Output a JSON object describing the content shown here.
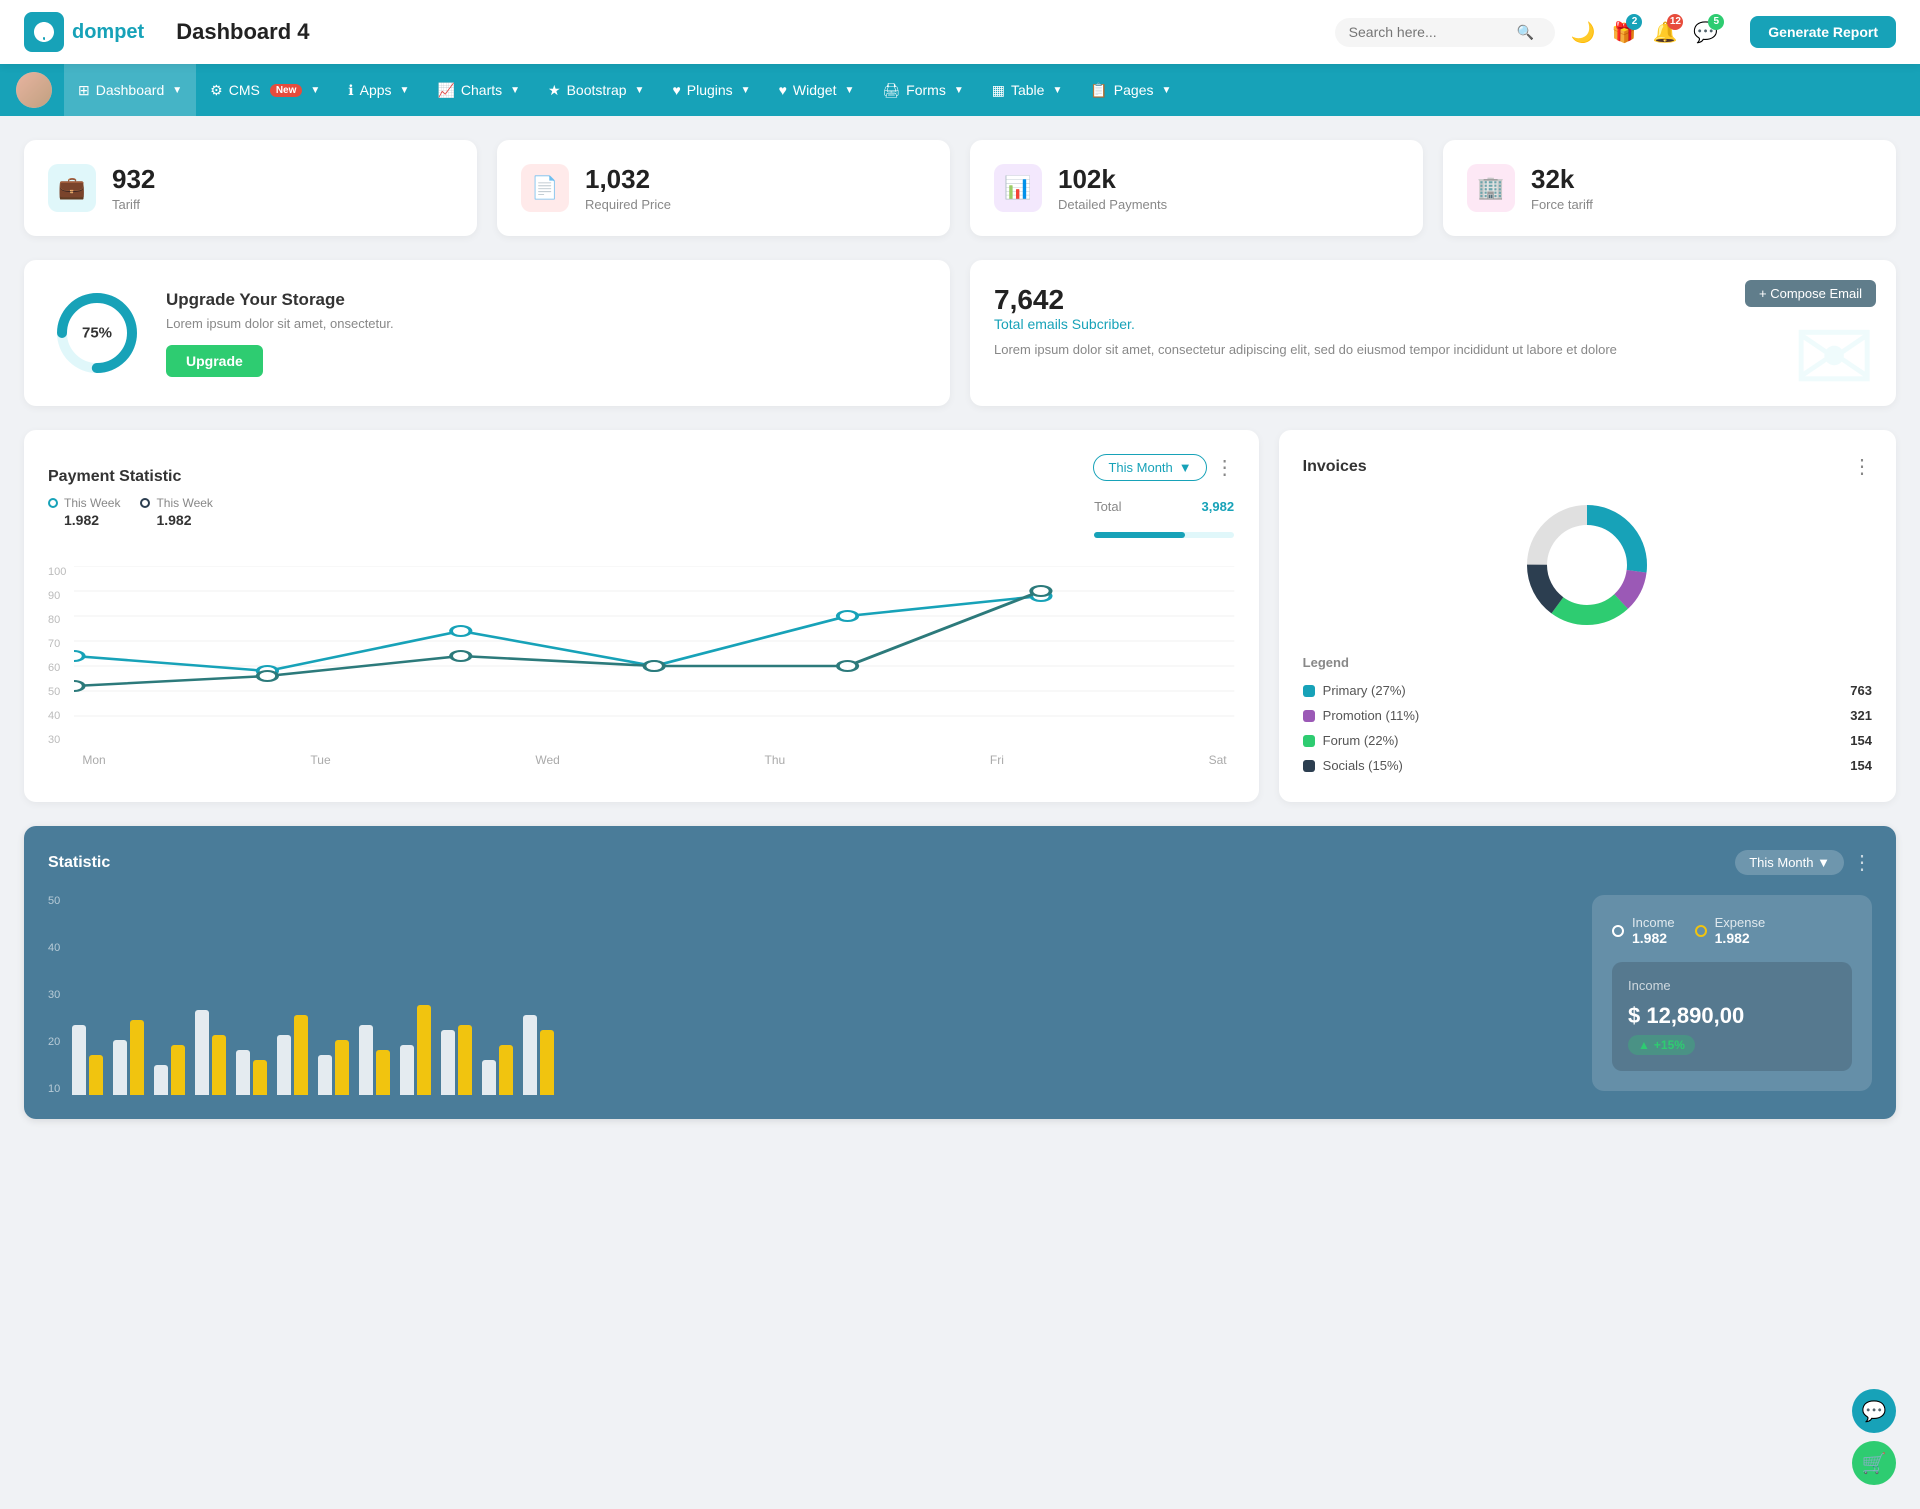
{
  "header": {
    "logo_text": "dompet",
    "page_title": "Dashboard 4",
    "search_placeholder": "Search here...",
    "generate_btn": "Generate Report",
    "icons": {
      "gift_badge": "2",
      "bell_badge": "12",
      "chat_badge": "5"
    }
  },
  "navbar": {
    "items": [
      {
        "id": "dashboard",
        "label": "Dashboard",
        "active": true,
        "has_arrow": true
      },
      {
        "id": "cms",
        "label": "CMS",
        "active": false,
        "has_arrow": true,
        "badge": "New"
      },
      {
        "id": "apps",
        "label": "Apps",
        "active": false,
        "has_arrow": true
      },
      {
        "id": "charts",
        "label": "Charts",
        "active": false,
        "has_arrow": true
      },
      {
        "id": "bootstrap",
        "label": "Bootstrap",
        "active": false,
        "has_arrow": true
      },
      {
        "id": "plugins",
        "label": "Plugins",
        "active": false,
        "has_arrow": true
      },
      {
        "id": "widget",
        "label": "Widget",
        "active": false,
        "has_arrow": true
      },
      {
        "id": "forms",
        "label": "Forms",
        "active": false,
        "has_arrow": true
      },
      {
        "id": "table",
        "label": "Table",
        "active": false,
        "has_arrow": true
      },
      {
        "id": "pages",
        "label": "Pages",
        "active": false,
        "has_arrow": true
      }
    ]
  },
  "stat_cards": [
    {
      "id": "tariff",
      "icon": "💼",
      "icon_class": "teal",
      "value": "932",
      "label": "Tariff"
    },
    {
      "id": "required_price",
      "icon": "📄",
      "icon_class": "red",
      "value": "1,032",
      "label": "Required Price"
    },
    {
      "id": "detailed_payments",
      "icon": "📊",
      "icon_class": "purple",
      "value": "102k",
      "label": "Detailed Payments"
    },
    {
      "id": "force_tariff",
      "icon": "🏢",
      "icon_class": "pink",
      "value": "32k",
      "label": "Force tariff"
    }
  ],
  "upgrade_card": {
    "pct": "75%",
    "pct_num": 75,
    "title": "Upgrade Your Storage",
    "description": "Lorem ipsum dolor sit amet, onsectetur.",
    "btn_label": "Upgrade"
  },
  "email_card": {
    "number": "7,642",
    "subtitle": "Total emails Subcriber.",
    "description": "Lorem ipsum dolor sit amet, consectetur adipiscing elit, sed do eiusmod tempor incididunt ut labore et dolore",
    "compose_btn": "+ Compose Email"
  },
  "payment": {
    "title": "Payment Statistic",
    "filter_label": "This Month",
    "legend1_label": "This Week",
    "legend1_val": "1.982",
    "legend2_label": "This Week",
    "legend2_val": "1.982",
    "total_label": "Total",
    "total_val": "3,982",
    "progress_pct": 65,
    "x_labels": [
      "Mon",
      "Tue",
      "Wed",
      "Thu",
      "Fri",
      "Sat"
    ],
    "y_labels": [
      "100",
      "90",
      "80",
      "70",
      "60",
      "50",
      "40",
      "30"
    ],
    "line1_points": "0,60 100,50 200,30 300,65 400,35 500,20",
    "line2_points": "0,80 100,70 200,60 300,65 400,65 500,15"
  },
  "invoices": {
    "title": "Invoices",
    "legend_title": "Legend",
    "items": [
      {
        "label": "Primary (27%)",
        "color": "#17a2b8",
        "count": "763"
      },
      {
        "label": "Promotion (11%)",
        "color": "#9b59b6",
        "count": "321"
      },
      {
        "label": "Forum (22%)",
        "color": "#2ecc71",
        "count": "154"
      },
      {
        "label": "Socials (15%)",
        "color": "#2c3e50",
        "count": "154"
      }
    ],
    "donut": {
      "segments": [
        {
          "label": "Primary",
          "pct": 27,
          "color": "#17a2b8"
        },
        {
          "label": "Promotion",
          "pct": 11,
          "color": "#9b59b6"
        },
        {
          "label": "Forum",
          "pct": 22,
          "color": "#2ecc71"
        },
        {
          "label": "Socials",
          "pct": 15,
          "color": "#2c3e50"
        }
      ]
    }
  },
  "statistic": {
    "title": "Statistic",
    "filter_label": "This Month",
    "y_labels": [
      "50",
      "40",
      "30",
      "20",
      "10"
    ],
    "income_label": "Income",
    "income_val": "1.982",
    "expense_label": "Expense",
    "expense_val": "1.982",
    "income_details": {
      "title": "Income",
      "amount": "$ 12,890,00",
      "badge": "+15%"
    },
    "bars": [
      {
        "white": 70,
        "yellow": 40
      },
      {
        "white": 55,
        "yellow": 75
      },
      {
        "white": 30,
        "yellow": 50
      },
      {
        "white": 85,
        "yellow": 60
      },
      {
        "white": 45,
        "yellow": 35
      },
      {
        "white": 60,
        "yellow": 80
      },
      {
        "white": 40,
        "yellow": 55
      },
      {
        "white": 70,
        "yellow": 45
      },
      {
        "white": 50,
        "yellow": 90
      },
      {
        "white": 65,
        "yellow": 70
      },
      {
        "white": 35,
        "yellow": 50
      },
      {
        "white": 80,
        "yellow": 65
      }
    ]
  },
  "fab": {
    "btn1_icon": "💬",
    "btn2_icon": "🛒"
  }
}
